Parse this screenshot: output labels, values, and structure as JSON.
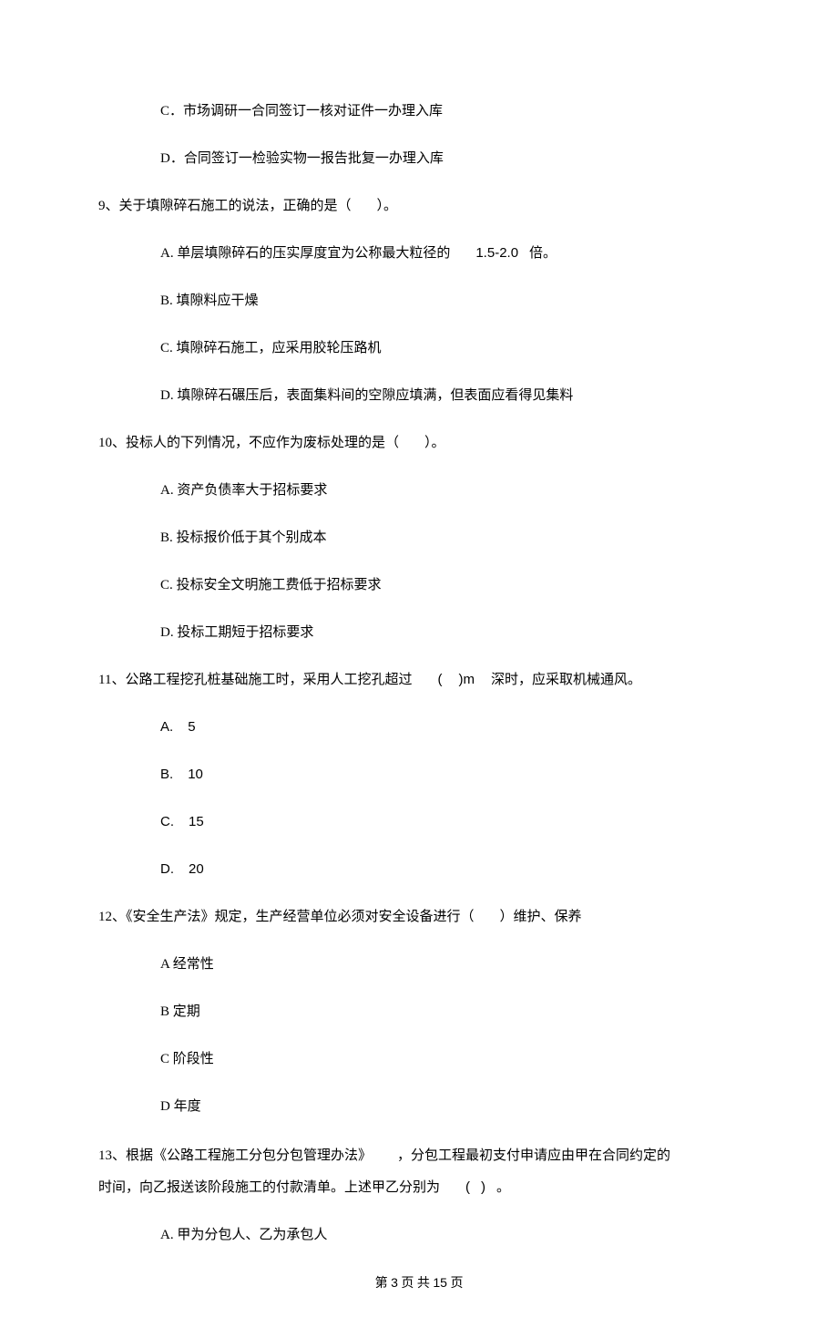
{
  "leading_options": {
    "c": "C．市场调研一合同签订一核对证件一办理入库",
    "d": "D．合同签订一检验实物一报告批复一办理入库"
  },
  "q9": {
    "stem_pre": "9、关于填隙碎石施工的说法，正确的是（",
    "stem_post": "）。",
    "a_pre": "A. 单层填隙碎石的压实厚度宜为公称最大粒径的",
    "a_val": "1.5-2.0",
    "a_post": "倍。",
    "b": "B. 填隙料应干燥",
    "c": "C. 填隙碎石施工，应采用胶轮压路机",
    "d": "D. 填隙碎石碾压后，表面集料间的空隙应填满，但表面应看得见集料"
  },
  "q10": {
    "stem_pre": "10、投标人的下列情况，不应作为废标处理的是（",
    "stem_post": "）。",
    "a": "A. 资产负债率大于招标要求",
    "b": "B. 投标报价低于其个别成本",
    "c": "C. 投标安全文明施工费低于招标要求",
    "d": "D. 投标工期短于招标要求"
  },
  "q11": {
    "stem_pre": "11、公路工程挖孔桩基础施工时，采用人工挖孔超过",
    "stem_mid_l": "(",
    "stem_mid_r": ")m",
    "stem_post": "深时，应采取机械通风。",
    "a_l": "A.",
    "a_v": "5",
    "b_l": "B.",
    "b_v": "10",
    "c_l": "C.",
    "c_v": "15",
    "d_l": "D.",
    "d_v": "20"
  },
  "q12": {
    "stem_pre": "12、《安全生产法》规定，生产经营单位必须对安全设备进行（",
    "stem_post": "）维护、保养",
    "a": "A  经常性",
    "b": "B  定期",
    "c": "C  阶段性",
    "d": "D  年度"
  },
  "q13": {
    "stem_a": "13、根据《公路工程施工分包分包管理办法》",
    "stem_b": "，分包工程最初支付申请应由甲在合同约定的",
    "stem_c": "时间，向乙报送该阶段施工的付款清单。上述甲乙分别为",
    "stem_d_l": "(",
    "stem_d_r": ")",
    "stem_d_dot": "。",
    "a": "A. 甲为分包人、乙为承包人"
  },
  "footer": {
    "a": "第",
    "b": "3",
    "c": "页 共",
    "d": "15",
    "e": "页"
  }
}
